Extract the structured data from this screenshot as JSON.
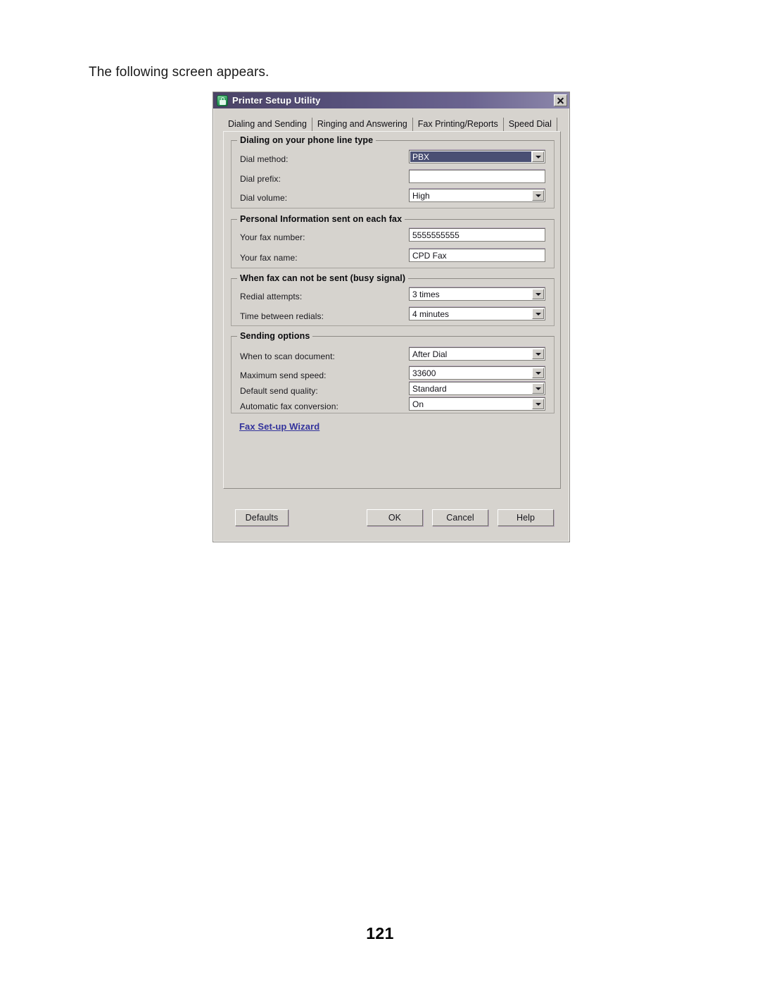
{
  "page": {
    "intro_text": "The following screen appears.",
    "page_number": "121"
  },
  "dialog": {
    "title": "Printer Setup Utility",
    "title_icon": "printer-setup-icon",
    "close_icon": "close-icon",
    "tabs": [
      {
        "label": "Dialing and Sending",
        "active": true
      },
      {
        "label": "Ringing and Answering",
        "active": false
      },
      {
        "label": "Fax Printing/Reports",
        "active": false
      },
      {
        "label": "Speed Dial",
        "active": false
      }
    ],
    "groups": {
      "phone_line": {
        "legend": "Dialing on your phone line type",
        "dial_method": {
          "label": "Dial method:",
          "value": "PBX"
        },
        "dial_prefix": {
          "label": "Dial prefix:",
          "value": ""
        },
        "dial_volume": {
          "label": "Dial volume:",
          "value": "High"
        }
      },
      "personal_info": {
        "legend": "Personal Information sent on each fax",
        "fax_number": {
          "label": "Your fax number:",
          "value": "5555555555"
        },
        "fax_name": {
          "label": "Your fax name:",
          "value": "CPD Fax"
        }
      },
      "busy_signal": {
        "legend": "When fax can not be sent (busy signal)",
        "redial_attempts": {
          "label": "Redial attempts:",
          "value": "3 times"
        },
        "time_between_redials": {
          "label": "Time between redials:",
          "value": "4 minutes"
        }
      },
      "sending_options": {
        "legend": "Sending options",
        "when_to_scan": {
          "label": "When to scan document:",
          "value": "After Dial"
        },
        "max_send_speed": {
          "label": "Maximum send speed:",
          "value": "33600"
        },
        "default_send_quality": {
          "label": "Default send quality:",
          "value": "Standard"
        },
        "automatic_fax_conversion": {
          "label": "Automatic fax conversion:",
          "value": "On"
        }
      }
    },
    "wizard_link": "Fax Set-up Wizard",
    "buttons": {
      "defaults": "Defaults",
      "ok": "OK",
      "cancel": "Cancel",
      "help": "Help"
    }
  },
  "colors": {
    "titlebar": "#4b4366",
    "dialog_face": "#d6d3ce",
    "link": "#33339c",
    "combo_focus": "#4a4f73"
  }
}
